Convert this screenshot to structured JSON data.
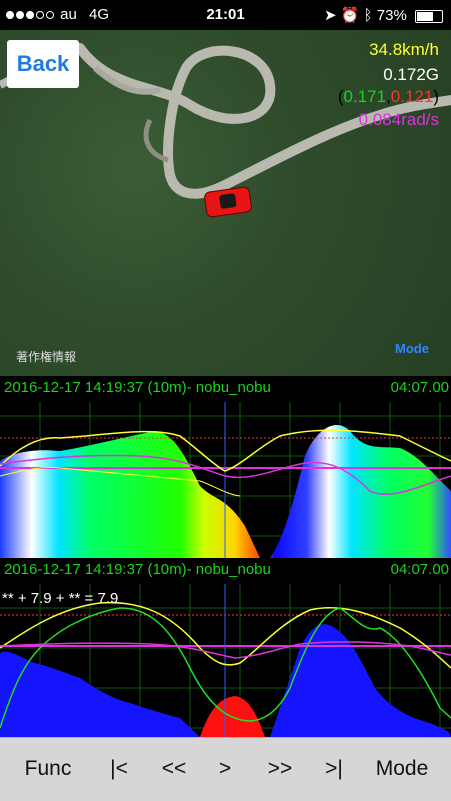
{
  "status": {
    "carrier": "au",
    "network": "4G",
    "time": "21:01",
    "battery": "73%",
    "battery_level": 0.73
  },
  "map": {
    "back_label": "Back",
    "speed": "34.8km/h",
    "g_force": "0.172G",
    "g_split_open": "(",
    "g_split_a": "0.171",
    "g_split_sep": ",",
    "g_split_b": "0.121",
    "g_split_close": ")",
    "yaw": "0.084rad/s",
    "copyright": "著作権情報",
    "mode_label": "Mode"
  },
  "graph1": {
    "title": "2016-12-17 14:19:37 (10m)- nobu_nobu",
    "duration": "04:07.00"
  },
  "graph2": {
    "title": "2016-12-17 14:19:37 (10m)- nobu_nobu",
    "duration": "04:07.00",
    "formula": "** + 7.9 + ** = 7.9"
  },
  "toolbar": {
    "func": "Func",
    "first": "|<",
    "rewind": "<<",
    "play": ">",
    "forward": ">>",
    "last": ">|",
    "mode": "Mode"
  },
  "colors": {
    "speed": "#ffff33",
    "accent": "#1e7be0",
    "green": "#19d419",
    "red": "#ff3030",
    "magenta": "#dd33dd"
  }
}
